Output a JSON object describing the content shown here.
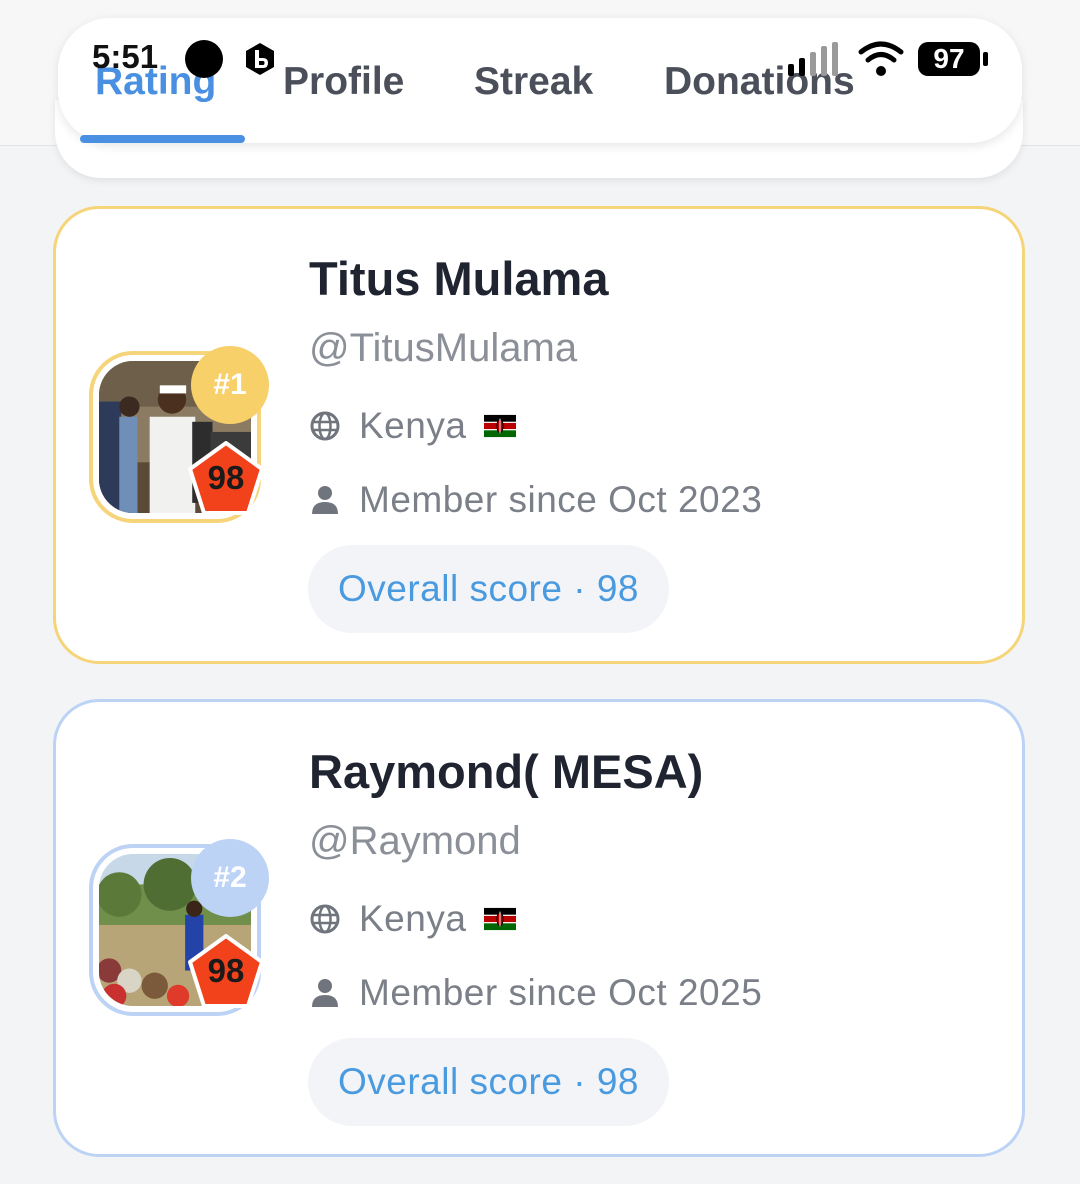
{
  "status_bar": {
    "time": "5:51",
    "battery": "97"
  },
  "tabs": [
    {
      "label": "Rating",
      "active": true
    },
    {
      "label": "Profile",
      "active": false
    },
    {
      "label": "Streak",
      "active": false
    },
    {
      "label": "Donations",
      "active": false
    }
  ],
  "users": [
    {
      "rank": "#1",
      "name": "Titus Mulama",
      "handle": "@TitusMulama",
      "country": "Kenya",
      "member_since": "Member since Oct 2023",
      "score_badge": "98",
      "overall_score": "Overall score · 98"
    },
    {
      "rank": "#2",
      "name": "Raymond( MESA)",
      "handle": "@Raymond",
      "country": "Kenya",
      "member_since": "Member since Oct 2025",
      "score_badge": "98",
      "overall_score": "Overall score · 98"
    }
  ],
  "colors": {
    "accent": "#4a90e2",
    "gold": "#f6d47a",
    "silver_blue": "#bcd3f5",
    "score_badge": "#f2421b"
  },
  "icons": [
    "globe-icon",
    "person-icon",
    "kenya-flag",
    "signal-icon",
    "wifi-icon",
    "battery-icon"
  ]
}
